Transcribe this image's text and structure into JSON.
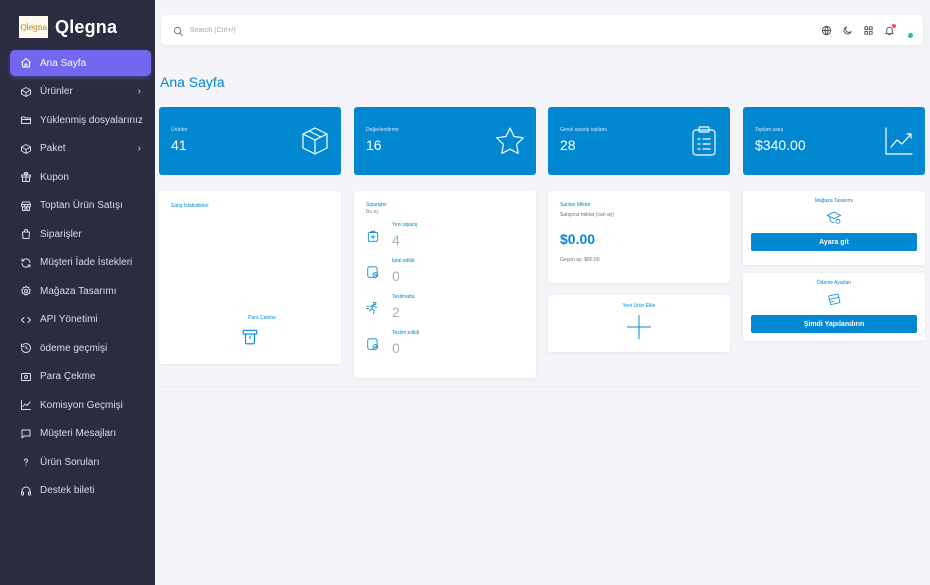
{
  "brand": {
    "logo_text": "Qlegna",
    "name": "Qlegna"
  },
  "sidebar": {
    "items": [
      {
        "label": "Ana Sayfa",
        "icon": "home-icon",
        "active": true,
        "chevron": false
      },
      {
        "label": "Ürünler",
        "icon": "box-icon",
        "chevron": true
      },
      {
        "label": "Yüklenmiş dosyalarınız",
        "icon": "folder-icon",
        "chevron": false
      },
      {
        "label": "Paket",
        "icon": "package-icon",
        "chevron": true
      },
      {
        "label": "Kupon",
        "icon": "gift-icon",
        "chevron": false
      },
      {
        "label": "Toptan Ürün Satışı",
        "icon": "store-icon",
        "chevron": false
      },
      {
        "label": "Siparişler",
        "icon": "shopping-bag-icon",
        "chevron": false
      },
      {
        "label": "Müşteri İade İstekleri",
        "icon": "refresh-icon",
        "chevron": false
      },
      {
        "label": "Mağaza Tasarımı",
        "icon": "settings-icon",
        "chevron": false
      },
      {
        "label": "API Yönetimi",
        "icon": "code-icon",
        "chevron": false
      },
      {
        "label": "ödeme geçmişi",
        "icon": "history-icon",
        "chevron": false
      },
      {
        "label": "Para Çekme",
        "icon": "cash-icon",
        "chevron": false
      },
      {
        "label": "Komisyon Geçmişi",
        "icon": "chart-line-icon",
        "chevron": false
      },
      {
        "label": "Müşteri Mesajları",
        "icon": "message-icon",
        "chevron": false
      },
      {
        "label": "Ürün Soruları",
        "icon": "question-icon",
        "chevron": false
      },
      {
        "label": "Destek bileti",
        "icon": "headset-icon",
        "chevron": false
      }
    ],
    "chevron_glyph": "›"
  },
  "navbar": {
    "search_placeholder": "Search (Ctrl+/)",
    "icons": [
      "globe-icon",
      "moon-icon",
      "grid-icon",
      "bell-icon"
    ]
  },
  "page": {
    "title": "Ana Sayfa"
  },
  "stats": [
    {
      "label": "Ürünler",
      "value": "41",
      "icon": "cube-icon"
    },
    {
      "label": "Değerlendirme",
      "value": "16",
      "icon": "star-icon"
    },
    {
      "label": "Genel sipariş toplamı",
      "value": "28",
      "icon": "clipboard-icon"
    },
    {
      "label": "Toplam satış",
      "value": "$340.00",
      "icon": "trend-icon"
    }
  ],
  "sales_stats": {
    "title": "Satış İstatistikleri"
  },
  "withdraw": {
    "title": "Para Çekme"
  },
  "orders": {
    "title": "Siparişler",
    "subtitle": "Bu ay",
    "rows": [
      {
        "label": "Yeni sipariş",
        "value": "4",
        "icon": "new-order-icon"
      },
      {
        "label": "İptal edildi",
        "value": "0",
        "icon": "cancelled-icon"
      },
      {
        "label": "Teslimatta",
        "value": "2",
        "icon": "running-icon"
      },
      {
        "label": "Teslim edildi",
        "value": "0",
        "icon": "delivered-icon"
      }
    ]
  },
  "sold": {
    "title": "Satılan Miktar",
    "subtitle": "Satışınız miktar (cari ay)",
    "amount": "$0.00",
    "previous": "Geçen ay: $80.00"
  },
  "add_product": {
    "title": "Yeni Ürün Ekle"
  },
  "store_design": {
    "title": "Mağaza Tasarımı",
    "button": "Ayara git"
  },
  "payment_settings": {
    "title": "Ödeme Ayarları",
    "button": "Şimdi Yapılandırın"
  },
  "colors": {
    "primary": "#0288d1",
    "sidebar": "#2b2c40",
    "active": "#7367f0"
  }
}
